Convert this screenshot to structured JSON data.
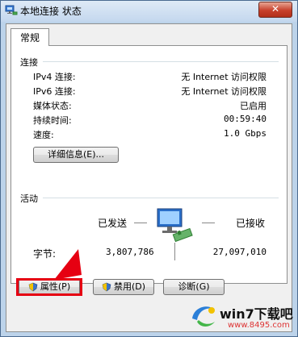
{
  "window": {
    "title": "本地连接 状态",
    "close_label": "✕"
  },
  "tabs": [
    {
      "label": "常规"
    }
  ],
  "connection": {
    "group_label": "连接",
    "rows": [
      {
        "label": "IPv4 连接:",
        "value": "无 Internet 访问权限"
      },
      {
        "label": "IPv6 连接:",
        "value": "无 Internet 访问权限"
      },
      {
        "label": "媒体状态:",
        "value": "已启用"
      },
      {
        "label": "持续时间:",
        "value": "00:59:40"
      },
      {
        "label": "速度:",
        "value": "1.0 Gbps"
      }
    ],
    "details_button": "详细信息(E)..."
  },
  "activity": {
    "group_label": "活动",
    "sent_label": "已发送",
    "received_label": "已接收",
    "bytes_label": "字节:",
    "bytes_sent": "3,807,786",
    "bytes_received": "27,097,010"
  },
  "buttons": {
    "properties": "属性(P)",
    "disable": "禁用(D)",
    "diagnose": "诊断(G)"
  },
  "watermark": {
    "text": "win7下载吧",
    "url": "www.8495.com"
  },
  "colors": {
    "highlight": "#e60012",
    "titlebar": "#c3d7ee",
    "close": "#c7402b"
  }
}
